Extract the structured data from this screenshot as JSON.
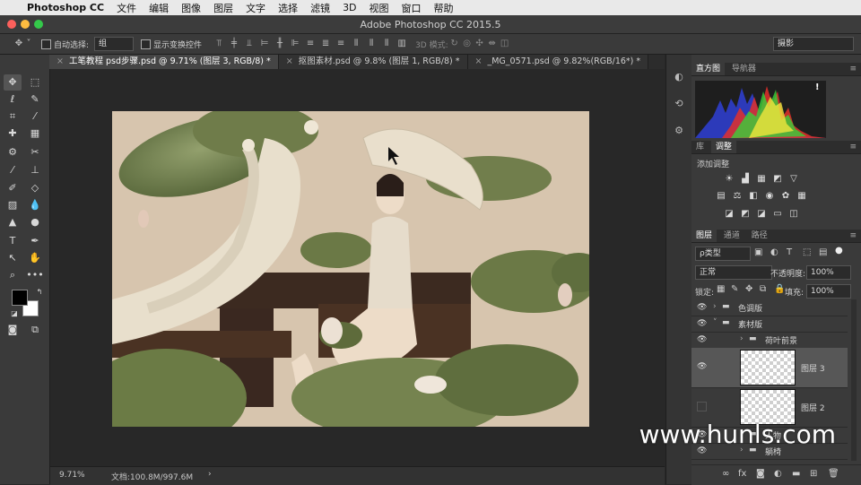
{
  "menubar": {
    "app_name": "Photoshop CC",
    "items": [
      "文件",
      "编辑",
      "图像",
      "图层",
      "文字",
      "选择",
      "滤镜",
      "3D",
      "视图",
      "窗口",
      "帮助"
    ]
  },
  "window": {
    "title": "Adobe Photoshop CC 2015.5"
  },
  "options_bar": {
    "auto_select_label": "自动选择:",
    "auto_select_value": "组",
    "show_transform_label": "显示变换控件",
    "mode_3d_label": "3D 模式:",
    "workspace": "摄影"
  },
  "tabs": [
    {
      "label": "工笔教程 psd步骤.psd @ 9.71% (图层 3, RGB/8) *",
      "active": true
    },
    {
      "label": "抠图素材.psd @ 9.8% (图层 1, RGB/8) *",
      "active": false
    },
    {
      "label": "_MG_0571.psd @ 9.82%(RGB/16*) *",
      "active": false
    }
  ],
  "status": {
    "zoom": "9.71%",
    "doc_size": "文档:100.8M/997.6M",
    "arrow": "›"
  },
  "panels": {
    "histogram": {
      "tabs": [
        "直方图",
        "导航器"
      ],
      "warning": "!"
    },
    "adjust": {
      "tabs": [
        "库",
        "调整"
      ],
      "add_label": "添加调整"
    },
    "layers": {
      "tabs": [
        "图层",
        "通道",
        "路径"
      ],
      "filter_kind": "ρ类型",
      "blend_mode": "正常",
      "opacity_label": "不透明度:",
      "opacity_value": "100%",
      "lock_label": "锁定:",
      "fill_label": "填充:",
      "fill_value": "100%",
      "rows": [
        {
          "name": "色调版",
          "type": "group"
        },
        {
          "name": "素材版",
          "type": "group"
        },
        {
          "name": "荷叶前景",
          "type": "group"
        },
        {
          "name": "图层 3",
          "type": "layer"
        },
        {
          "name": "图层 2",
          "type": "layer"
        },
        {
          "name": "人物",
          "type": "group"
        },
        {
          "name": "躺椅",
          "type": "group"
        }
      ]
    }
  },
  "watermark": "www.hunls.com",
  "colors": {
    "accent_close": "#fc605c",
    "accent_min": "#fdbc40",
    "accent_max": "#34c84a",
    "canvas_bg": "#d7c5ae"
  }
}
